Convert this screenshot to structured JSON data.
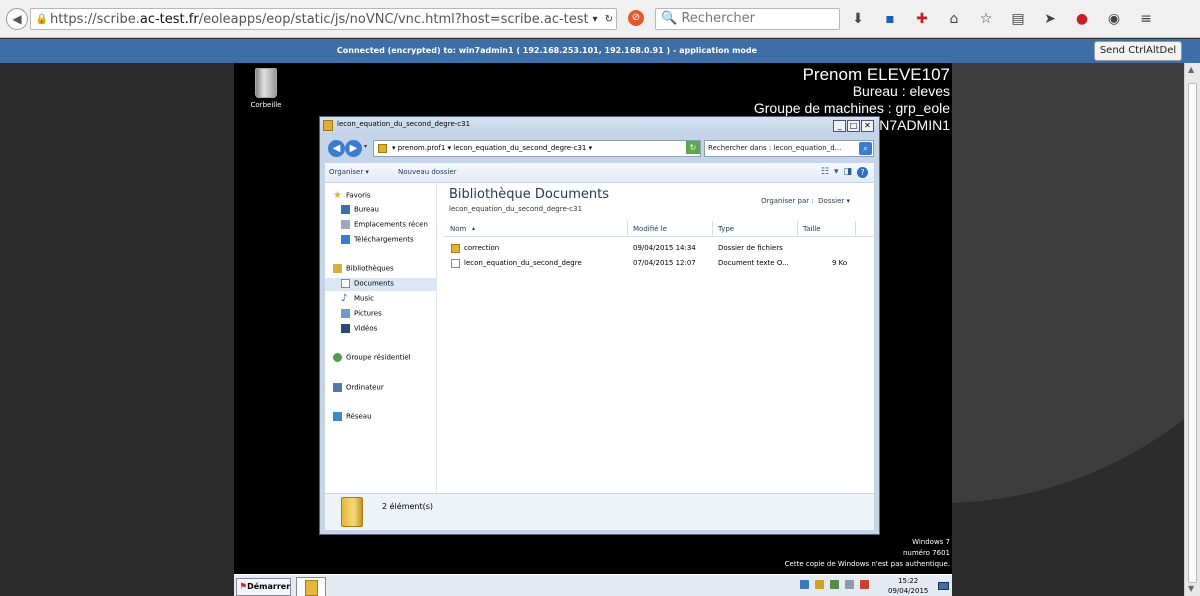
{
  "browser": {
    "url_prefix": "https://scribe.",
    "url_domain": "ac-test.fr",
    "url_rest": "/eoleapps/eop/static/js/noVNC/vnc.html?host=scribe.ac-test.fr&p",
    "search_placeholder": "Rechercher"
  },
  "vnc": {
    "status": "Connected (encrypted) to: win7admin1 ( 192.168.253.101, 192.168.0.91 ) - application mode",
    "send_cad_label": "Send CtrlAltDel"
  },
  "desktop": {
    "recycle_label": "Corbeille",
    "user_name": "Prenom ELEVE107",
    "bureau": "Bureau : eleves",
    "groupe": "Groupe de machines : grp_eole",
    "machine": "N7ADMIN1",
    "win_line1": "Windows 7",
    "win_line2": "numéro 7601",
    "win_line3": "Cette copie de Windows n'est pas authentique."
  },
  "explorer": {
    "title": "lecon_equation_du_second_degre-c31",
    "address": "▾  prenom.prof1  ▾  lecon_equation_du_second_degre-c31  ▾",
    "search_placeholder": "Rechercher dans : lecon_equation_d...",
    "organiser": "Organiser ▾",
    "nouveau_dossier": "Nouveau dossier",
    "nav": {
      "favoris": "Favoris",
      "bureau": "Bureau",
      "emplacements": "Emplacements récen",
      "telechargements": "Téléchargements",
      "bibliotheques": "Bibliothèques",
      "documents": "Documents",
      "music": "Music",
      "pictures": "Pictures",
      "videos": "Vidéos",
      "groupe": "Groupe résidentiel",
      "ordinateur": "Ordinateur",
      "reseau": "Réseau"
    },
    "library_title": "Bibliothèque Documents",
    "library_path": "lecon_equation_du_second_degre-c31",
    "arrange_label": "Organiser par :",
    "arrange_value": "Dossier ▾",
    "columns": [
      "Nom",
      "Modifié le",
      "Type",
      "Taille"
    ],
    "files": [
      {
        "name": "correction",
        "modified": "09/04/2015 14:34",
        "type": "Dossier de fichiers",
        "size": "",
        "icon": "folder-icon"
      },
      {
        "name": "lecon_equation_du_second_degre",
        "modified": "07/04/2015 12:07",
        "type": "Document texte O...",
        "size": "9 Ko",
        "icon": "text-document-icon"
      }
    ],
    "item_count": "2 élément(s)"
  },
  "taskbar": {
    "start_label": "Démarrer",
    "time": "15:22",
    "date": "09/04/2015"
  },
  "colors": {
    "vnc_bar": "#3e6ea6",
    "desktop": "#000000",
    "explorer_frame": "#c6d4e8"
  }
}
